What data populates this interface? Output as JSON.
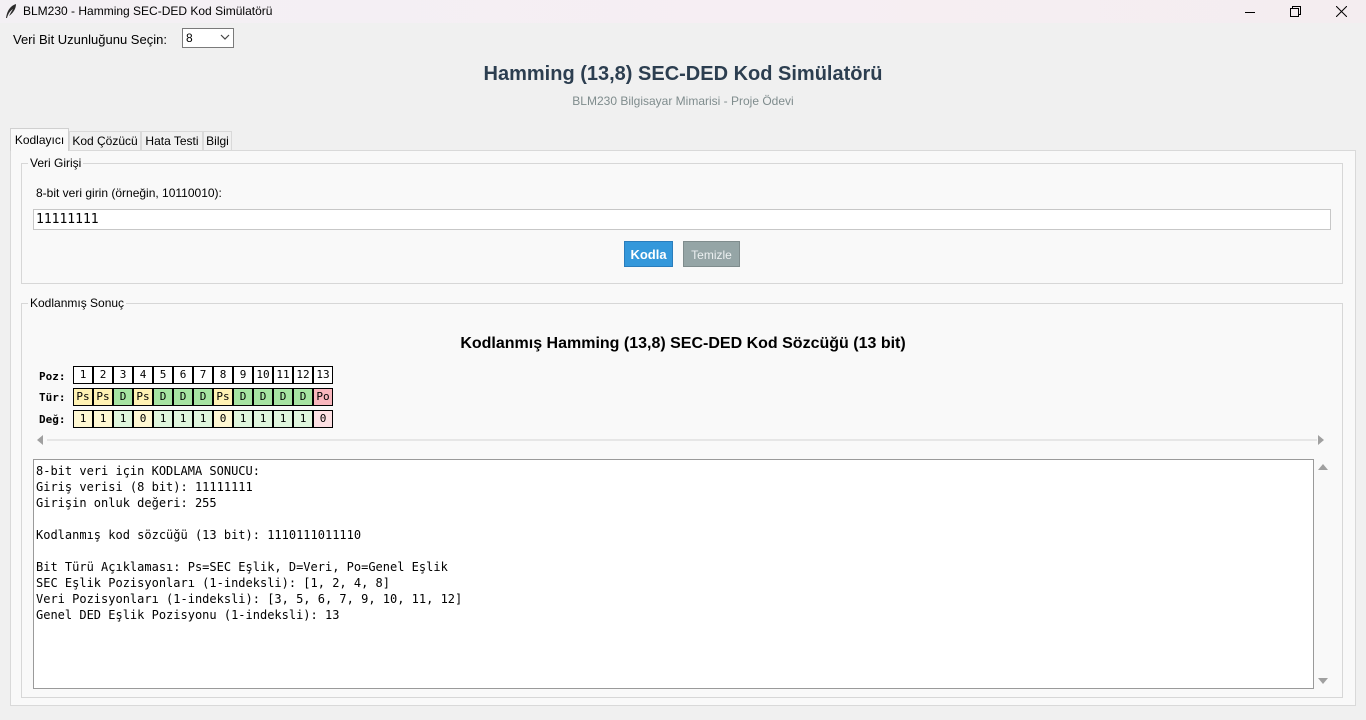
{
  "window": {
    "title": "BLM230 - Hamming SEC-DED Kod Simülatörü",
    "icons": [
      "feather-icon",
      "minimize-icon",
      "maximize-icon",
      "close-icon"
    ]
  },
  "bit_length": {
    "label": "Veri Bit Uzunluğunu Seçin:",
    "value": "8"
  },
  "header": {
    "title": "Hamming (13,8) SEC-DED Kod Simülatörü",
    "subtitle": "BLM230 Bilgisayar Mimarisi - Proje Ödevi"
  },
  "tabs": [
    {
      "label": "Kodlayıcı",
      "active": true
    },
    {
      "label": "Kod Çözücü",
      "active": false
    },
    {
      "label": "Hata Testi",
      "active": false
    },
    {
      "label": "Bilgi",
      "active": false
    }
  ],
  "data_entry": {
    "frame_title": "Veri Girişi",
    "prompt": "8-bit veri girin (örneğin, 10110010):",
    "value": "11111111",
    "encode_label": "Kodla",
    "clear_label": "Temizle"
  },
  "result": {
    "frame_title": "Kodlanmış Sonuç",
    "title": "Kodlanmış Hamming (13,8) SEC-DED Kod Sözcüğü (13 bit)",
    "row_labels": {
      "pos": "Poz:",
      "type": "Tür:",
      "value": "Değ:"
    },
    "positions": [
      "1",
      "2",
      "3",
      "4",
      "5",
      "6",
      "7",
      "8",
      "9",
      "10",
      "11",
      "12",
      "13"
    ],
    "types": [
      "Ps",
      "Ps",
      "D",
      "Ps",
      "D",
      "D",
      "D",
      "Ps",
      "D",
      "D",
      "D",
      "D",
      "Po"
    ],
    "values": [
      "1",
      "1",
      "1",
      "0",
      "1",
      "1",
      "1",
      "0",
      "1",
      "1",
      "1",
      "1",
      "0"
    ],
    "output_lines": [
      "8-bit veri için KODLAMA SONUCU:",
      "Giriş verisi (8 bit): 11111111",
      "Girişin onluk değeri: 255",
      "",
      "Kodlanmış kod sözcüğü (13 bit): 1110111011110",
      "",
      "Bit Türü Açıklaması: Ps=SEC Eşlik, D=Veri, Po=Genel Eşlik",
      "SEC Eşlik Pozisyonları (1-indeksli): [1, 2, 4, 8]",
      "Veri Pozisyonları (1-indeksli): [3, 5, 6, 7, 9, 10, 11, 12]",
      "Genel DED Eşlik Pozisyonu (1-indeksli): 13"
    ]
  },
  "colors": {
    "title": "#2c3e50",
    "subtitle": "#7f8c8d",
    "encode_button": "#3498db",
    "clear_button": "#95a5a6",
    "sec_parity": "#fff2b3",
    "data_bit": "#a6e3a1",
    "overall_parity": "#f9b6bd"
  }
}
